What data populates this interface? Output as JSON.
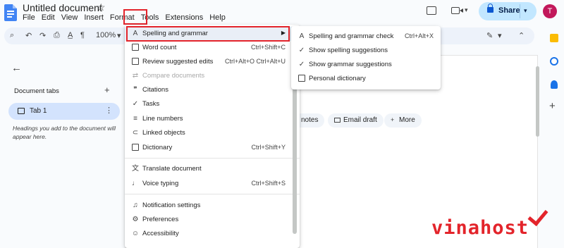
{
  "window": {
    "doc_title": "Untitled document",
    "menu": [
      "File",
      "Edit",
      "View",
      "Insert",
      "Format",
      "Tools",
      "Extensions",
      "Help"
    ],
    "share_label": "Share",
    "avatar_letter": "T",
    "zoom": "100%"
  },
  "sidebar": {
    "section_label": "Document tabs",
    "tab_label": "Tab 1",
    "outline_note": "Headings you add to the document will appear here."
  },
  "page_chips": {
    "notes": "notes",
    "email_draft": "Email draft",
    "more": "More"
  },
  "tools_menu": {
    "items": [
      {
        "label": "Spelling and grammar",
        "shortcut": "",
        "icon": "spellcheck-icon",
        "has_submenu": true
      },
      {
        "label": "Word count",
        "shortcut": "Ctrl+Shift+C",
        "icon": "word-count-icon"
      },
      {
        "label": "Review suggested edits",
        "shortcut": "Ctrl+Alt+O Ctrl+Alt+U",
        "icon": "review-icon"
      },
      {
        "label": "Compare documents",
        "shortcut": "",
        "icon": "compare-icon",
        "disabled": true
      },
      {
        "label": "Citations",
        "shortcut": "",
        "icon": "quote-icon"
      },
      {
        "label": "Tasks",
        "shortcut": "",
        "icon": "task-icon"
      },
      {
        "label": "Line numbers",
        "shortcut": "",
        "icon": "line-numbers-icon"
      },
      {
        "label": "Linked objects",
        "shortcut": "",
        "icon": "link-icon"
      },
      {
        "label": "Dictionary",
        "shortcut": "Ctrl+Shift+Y",
        "icon": "book-icon"
      },
      {
        "label": "Translate document",
        "shortcut": "",
        "icon": "translate-icon"
      },
      {
        "label": "Voice typing",
        "shortcut": "Ctrl+Shift+S",
        "icon": "mic-icon"
      },
      {
        "label": "Notification settings",
        "shortcut": "",
        "icon": "bell-icon"
      },
      {
        "label": "Preferences",
        "shortcut": "",
        "icon": "preferences-icon"
      },
      {
        "label": "Accessibility",
        "shortcut": "",
        "icon": "accessibility-icon"
      }
    ]
  },
  "submenu": {
    "items": [
      {
        "label": "Spelling and grammar check",
        "shortcut": "Ctrl+Alt+X",
        "icon": "spellcheck-icon"
      },
      {
        "label": "Show spelling suggestions",
        "shortcut": "",
        "icon": "check-icon"
      },
      {
        "label": "Show grammar suggestions",
        "shortcut": "",
        "icon": "check-icon"
      },
      {
        "label": "Personal dictionary",
        "shortcut": "",
        "icon": "book-icon"
      }
    ]
  },
  "watermark": "vinahost",
  "colors": {
    "highlight_border": "#e3242b",
    "share_bg": "#c2e7ff",
    "tab_active_bg": "#d3e3fd",
    "avatar_bg": "#c2185b"
  }
}
